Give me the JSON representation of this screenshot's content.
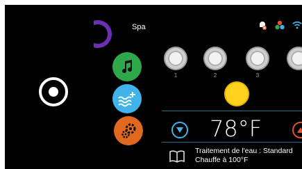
{
  "spa": {
    "label": "Spa"
  },
  "lights": [
    {
      "number": ""
    },
    {
      "number": "1"
    },
    {
      "number": "2"
    },
    {
      "number": "3"
    }
  ],
  "temperature": {
    "value": "78°F"
  },
  "water_treatment": {
    "line1": "Traitement de l'eau : Standard",
    "line2": "Chauffe à 100°F"
  },
  "icons": {
    "home": "home-button-icon",
    "spa": "spa-icon",
    "music": "music-note-icon",
    "water": "water-jets-icon",
    "settings": "gear-icon",
    "notification": "no-notification-icon",
    "color": "color-dots-icon",
    "wifi": "wifi-icon",
    "book": "book-icon"
  },
  "colors": {
    "music": "#2ea84a",
    "water": "#3fb3ea",
    "settings": "#e0691f",
    "spa": "#6b2fb3",
    "light_active": "#ffd21f",
    "temp_down": "#3fb3ea",
    "temp_up": "#e8512a"
  }
}
